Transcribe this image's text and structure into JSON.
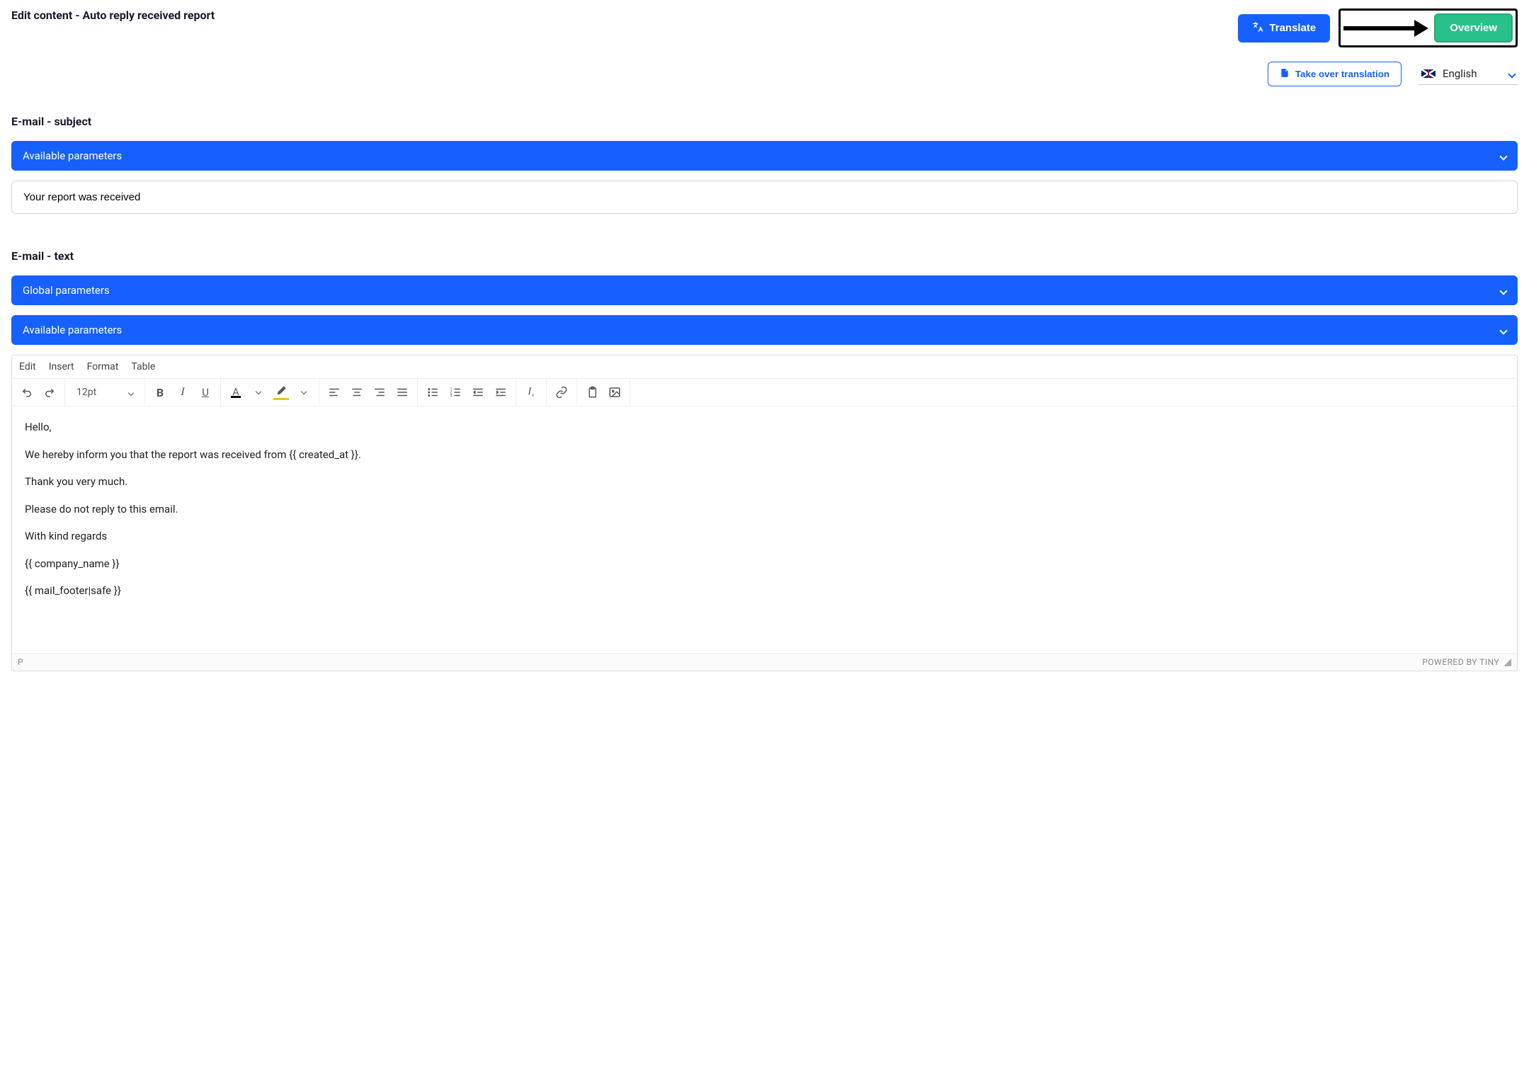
{
  "header": {
    "page_title": "Edit content - Auto reply received report",
    "translate_label": "Translate",
    "overview_label": "Overview",
    "takeover_label": "Take over translation",
    "language_label": "English"
  },
  "subject": {
    "section_label": "E-mail - subject",
    "accordion_label": "Available parameters",
    "value": "Your report was received"
  },
  "text": {
    "section_label": "E-mail - text",
    "global_accordion_label": "Global parameters",
    "available_accordion_label": "Available parameters"
  },
  "editor": {
    "menus": {
      "edit": "Edit",
      "insert": "Insert",
      "format": "Format",
      "table": "Table"
    },
    "font_size": "12pt",
    "content": {
      "line1": "Hello,",
      "line2": "We hereby inform you that the report was received from {{ created_at }}.",
      "line3": "Thank you very much.",
      "line4": "Please do not reply to this email.",
      "line5": "With kind regards",
      "line6": "{{ company_name }}",
      "line7": "{{ mail_footer|safe }}"
    },
    "footer_path": "P",
    "powered_by": "POWERED BY TINY"
  }
}
